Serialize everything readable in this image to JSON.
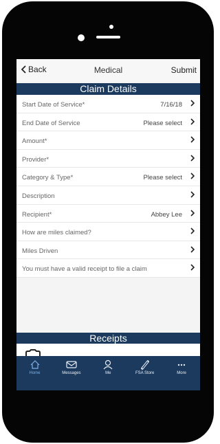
{
  "navbar": {
    "back_label": "Back",
    "title": "Medical",
    "submit_label": "Submit"
  },
  "sections": {
    "claim_details": "Claim Details",
    "receipts": "Receipts"
  },
  "rows": [
    {
      "label": "Start Date of Service*",
      "value": "7/16/18"
    },
    {
      "label": "End Date of Service",
      "value": "Please select"
    },
    {
      "label": "Amount*",
      "value": ""
    },
    {
      "label": "Provider*",
      "value": ""
    },
    {
      "label": "Category & Type*",
      "value": "Please select"
    },
    {
      "label": "Description",
      "value": ""
    },
    {
      "label": "Recipient*",
      "value": "Abbey Lee"
    },
    {
      "label": "How are miles claimed?",
      "value": ""
    },
    {
      "label": "Miles Driven",
      "value": ""
    },
    {
      "label": "You must have a valid receipt to file a claim",
      "value": ""
    }
  ],
  "tabs": [
    {
      "label": "Home",
      "icon": "home-icon",
      "active": true
    },
    {
      "label": "Messages",
      "icon": "mail-icon",
      "active": false
    },
    {
      "label": "Me",
      "icon": "person-icon",
      "active": false
    },
    {
      "label": "FSA Store",
      "icon": "pill-icon",
      "active": false
    },
    {
      "label": "More",
      "icon": "more-icon",
      "active": false
    }
  ],
  "colors": {
    "header": "#1b3a5e",
    "active_tab": "#7fb0e6"
  }
}
